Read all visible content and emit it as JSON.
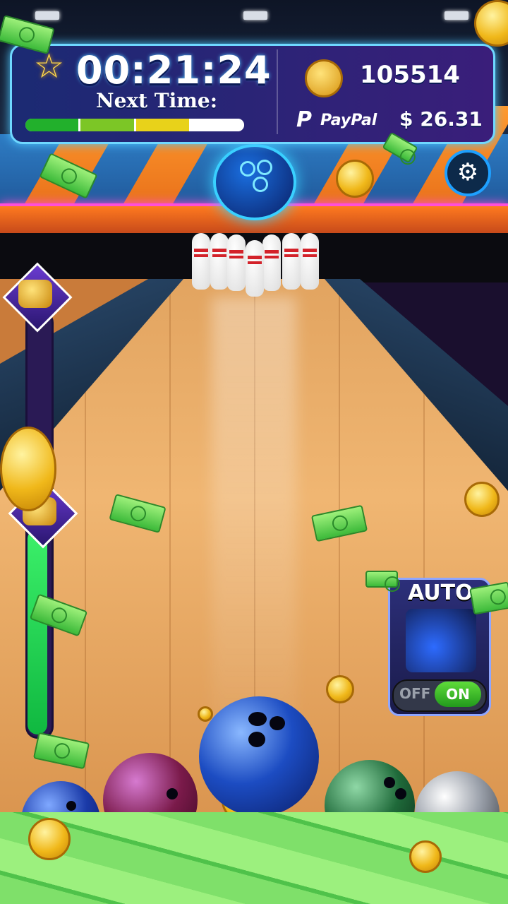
{
  "hud": {
    "timer": "00:21:24",
    "next_time_label": "Next  Time:",
    "progress_segments": [
      "#22b02c",
      "#7cc626",
      "#e8d21a",
      "#ffffff"
    ],
    "coin_count": "105514",
    "paypal_label": "PayPal",
    "cash_value": "$ 26.31"
  },
  "auto_panel": {
    "title": "AUTO",
    "toggle_off": "OFF",
    "toggle_on": "ON",
    "state": "on"
  },
  "meter": {
    "fill_fraction": 0.49
  },
  "colors": {
    "hud_border": "#6fd8ff",
    "neon": "#ff4fd8",
    "meter": "#22d44a",
    "toggle_on": "#3cbb2a"
  },
  "icons": {
    "star": "star-icon",
    "coin": "coin-icon",
    "paypal": "paypal-icon",
    "settings": "gear-icon"
  }
}
